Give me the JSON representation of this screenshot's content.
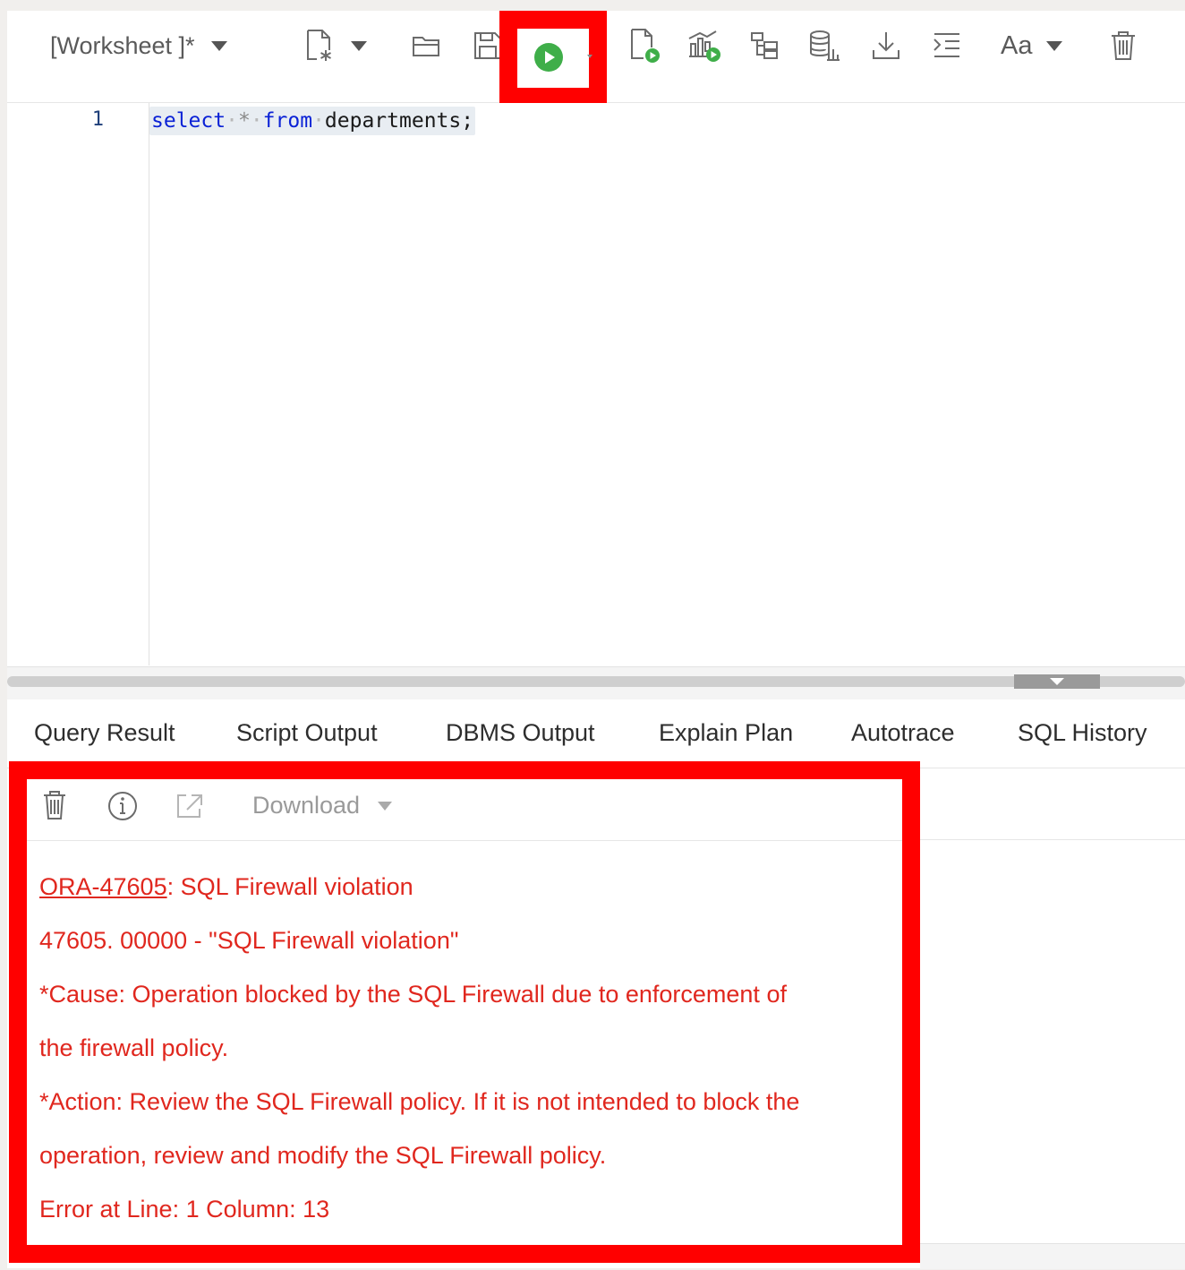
{
  "toolbar": {
    "worksheet_name": "[Worksheet ]*",
    "icons": [
      "new-worksheet-icon",
      "open-icon",
      "save-icon",
      "run-statement-icon",
      "run-script-icon",
      "autotrace-icon",
      "explain-plan-icon",
      "sql-tuning-icon",
      "download-icon",
      "format-icon",
      "font-case-icon",
      "clear-icon"
    ],
    "font_case_label": "Aa"
  },
  "editor": {
    "line_number": "1",
    "code": {
      "kw1": "select",
      "star": "*",
      "kw2": "from",
      "rest": "departments;"
    }
  },
  "tabs": [
    {
      "label": "Query Result"
    },
    {
      "label": "Script Output"
    },
    {
      "label": "DBMS Output"
    },
    {
      "label": "Explain Plan"
    },
    {
      "label": "Autotrace"
    },
    {
      "label": "SQL History"
    }
  ],
  "output": {
    "download_label": "Download",
    "error": {
      "code": "ORA-47605",
      "title_rest": ": SQL Firewall violation",
      "line2": "47605. 00000 -  \"SQL Firewall violation\"",
      "line3": "*Cause:    Operation blocked by the SQL Firewall due to enforcement of",
      "line4": "the firewall policy.",
      "line5": "*Action:   Review the SQL Firewall policy. If it is not intended to block the",
      "line6": "operation, review and modify the SQL Firewall policy.",
      "line7": "Error at Line: 1 Column: 13"
    }
  },
  "colors": {
    "highlight": "#ff0000",
    "error_text": "#e0271e",
    "run_green": "#3fae49",
    "keyword": "#0b22d6"
  }
}
